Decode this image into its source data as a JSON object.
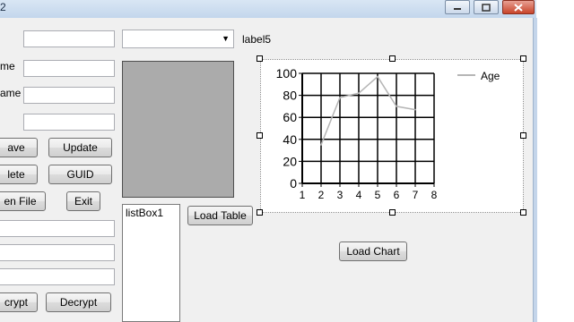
{
  "window": {
    "title": "2"
  },
  "icons": {
    "minimize": "minimize-icon",
    "maximize": "maximize-icon",
    "close": "close-icon",
    "dropdown": "chevron-down-icon"
  },
  "labels": {
    "name1": "me",
    "name2": "ame",
    "label5": "label5"
  },
  "buttons": {
    "save": "ave",
    "update": "Update",
    "delete": "lete",
    "guid": "GUID",
    "open_file": "en File",
    "exit": "Exit",
    "encrypt": "crypt",
    "decrypt": "Decrypt",
    "load_table": "Load Table",
    "load_chart": "Load Chart"
  },
  "inputs": {
    "field1": "",
    "field2": "",
    "field3": "",
    "field4": "",
    "field5": "",
    "field6": "",
    "field7": ""
  },
  "combobox": {
    "selected": ""
  },
  "listbox": {
    "items": [
      "listBox1"
    ]
  },
  "colors": {
    "series": "#b5b5b5",
    "grid": "#000000",
    "window": "#f0f0f0",
    "picture": "#ababab"
  },
  "chart_data": {
    "type": "line",
    "x": [
      2,
      3,
      4,
      5,
      6,
      7
    ],
    "series": [
      {
        "name": "Age",
        "values": [
          35,
          78,
          82,
          97,
          70,
          67
        ]
      }
    ],
    "xlim": [
      1,
      8
    ],
    "ylim": [
      0,
      100
    ],
    "xticks": [
      "1",
      "2",
      "3",
      "4",
      "5",
      "6",
      "7",
      "8"
    ],
    "yticks": [
      "0",
      "20",
      "40",
      "60",
      "80",
      "100"
    ],
    "grid": true,
    "legend": "top-right"
  }
}
